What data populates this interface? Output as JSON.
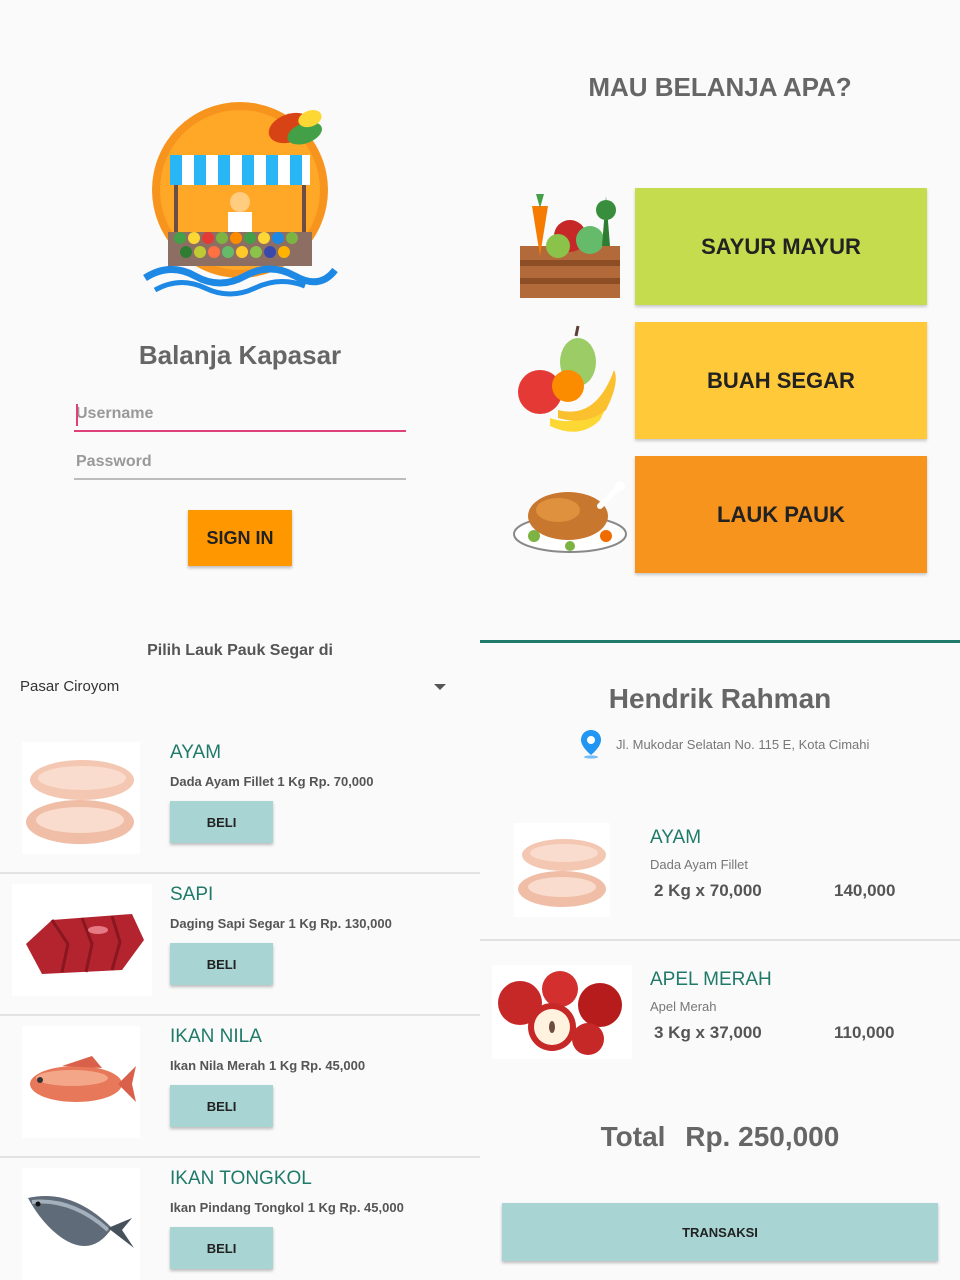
{
  "login": {
    "app_title": "Balanja Kapasar",
    "username_placeholder": "Username",
    "password_placeholder": "Password",
    "signin_label": "SIGN IN"
  },
  "menu": {
    "title": "MAU BELANJA APA?",
    "categories": [
      {
        "label": "SAYUR MAYUR",
        "color": "#c5dc4e",
        "icon": "vegetable-crate-icon"
      },
      {
        "label": "BUAH SEGAR",
        "color": "#ffc93a",
        "icon": "fruit-basket-icon"
      },
      {
        "label": "LAUK PAUK",
        "color": "#f7941e",
        "icon": "roast-chicken-icon"
      }
    ]
  },
  "list": {
    "heading": "Pilih Lauk Pauk Segar di",
    "market": "Pasar Ciroyom",
    "buy_label": "BELI",
    "items": [
      {
        "name": "AYAM",
        "desc": "Dada Ayam Fillet 1 Kg Rp. 70,000",
        "icon": "chicken-breast-icon"
      },
      {
        "name": "SAPI",
        "desc": "Daging Sapi Segar 1 Kg Rp. 130,000",
        "icon": "beef-icon"
      },
      {
        "name": "IKAN NILA",
        "desc": "Ikan Nila Merah 1 Kg Rp. 45,000",
        "icon": "tilapia-fish-icon"
      },
      {
        "name": "IKAN TONGKOL",
        "desc": "Ikan Pindang Tongkol 1 Kg Rp. 45,000",
        "icon": "tuna-fish-icon"
      }
    ]
  },
  "cart": {
    "customer_name": "Hendrik Rahman",
    "address": "Jl. Mukodar Selatan No. 115 E, Kota Cimahi",
    "items": [
      {
        "name": "AYAM",
        "sub": "Dada Ayam Fillet",
        "qty": "2 Kg x 70,000",
        "amount": "140,000",
        "icon": "chicken-breast-icon"
      },
      {
        "name": "APEL MERAH",
        "sub": "Apel Merah",
        "qty": "3 Kg x 37,000",
        "amount": "110,000",
        "icon": "red-apples-icon"
      }
    ],
    "total_label": "Total",
    "total_value": "Rp. 250,000",
    "transaction_label": "TRANSAKSI"
  },
  "colors": {
    "accent_orange": "#ff9800",
    "teal_text": "#1f7a6a",
    "button_teal": "#a9d4d4",
    "focus_pink": "#e0407a"
  }
}
